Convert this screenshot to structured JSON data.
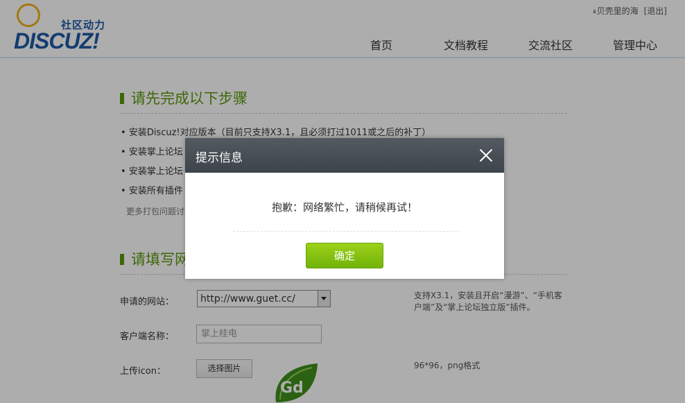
{
  "header": {
    "logo_tagline": "社区动力",
    "logo_text": "DISCUZ!",
    "username": "ء贝壳里的海",
    "logout": "[退出]",
    "nav": [
      "首页",
      "文档教程",
      "交流社区",
      "管理中心"
    ]
  },
  "steps_section": {
    "title": "请先完成以下步骤",
    "items": [
      "安装Discuz!对应版本（目前只支持X3.1，且必须打过1011或之后的补丁）",
      "安装掌上论坛",
      "安装掌上论坛",
      "安装所有插件"
    ],
    "more": "更多打包问题讨"
  },
  "form_section": {
    "title": "请填写网",
    "site_label": "申请的网站：",
    "site_value": "http://www.guet.cc/",
    "client_label": "客户端名称：",
    "client_placeholder": "掌上桂电",
    "icon_label": "上传icon：",
    "upload_button": "选择图片",
    "hint_site": "支持X3.1，安装且开启“漫游”、“手机客户端”及“掌上论坛独立版”插件。",
    "hint_icon": "96*96，png格式",
    "icon_letters": "Gd"
  },
  "dialog": {
    "title": "提示信息",
    "message": "抱歉：网络繁忙，请稍候再试！",
    "ok_label": "确定"
  },
  "colors": {
    "accent_green": "#5a9a0c",
    "brand_blue": "#1e5aa6",
    "dialog_header": "#464c53",
    "ok_button": "#84c212"
  }
}
